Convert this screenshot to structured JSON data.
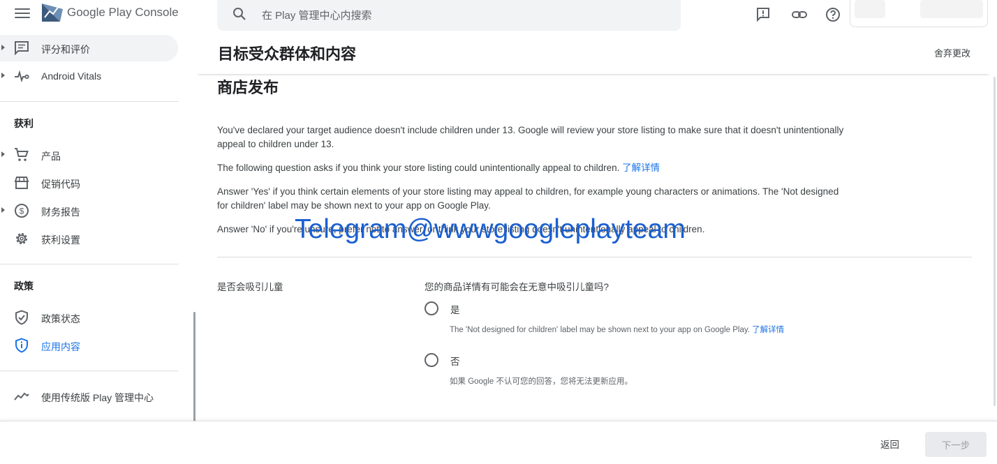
{
  "app": {
    "brand_prefix": "Google Play",
    "brand_suffix": "Console"
  },
  "search": {
    "placeholder": "在 Play 管理中心内搜索"
  },
  "sidebar": {
    "items_top": [
      {
        "label": "评分和评价",
        "icon": "reviews-icon"
      },
      {
        "label": "Android Vitals",
        "icon": "vitals-icon"
      }
    ],
    "monetize_title": "获利",
    "monetize_items": [
      {
        "label": "产品",
        "icon": "cart-icon"
      },
      {
        "label": "促销代码",
        "icon": "store-icon"
      },
      {
        "label": "财务报告",
        "icon": "dollar-icon"
      },
      {
        "label": "获利设置",
        "icon": "gear-icon"
      }
    ],
    "policy_title": "政策",
    "policy_items": [
      {
        "label": "政策状态",
        "icon": "shield-check-icon"
      },
      {
        "label": "应用内容",
        "icon": "shield-info-icon",
        "active": true
      }
    ],
    "legacy_item": {
      "label": "使用传统版 Play 管理中心",
      "icon": "trend-icon"
    }
  },
  "header": {
    "title": "目标受众群体和内容",
    "discard_label": "舍弃更改"
  },
  "content": {
    "section_title": "商店发布",
    "para1": "You've declared your target audience doesn't include children under 13. Google will review your store listing to make sure that it doesn't unintentionally appeal to children under 13.",
    "para2": "The following question asks if you think your store listing could unintentionally appeal to children.",
    "para2_link": "了解详情",
    "para3": "Answer 'Yes' if you think certain elements of your store listing may appeal to children, for example young characters or animations. The 'Not designed for children' label may be shown next to your app on Google Play.",
    "para4": "Answer 'No' if you're unsure, prefer not to answer, or think your store listing doesn't unintentionally appeal to children.",
    "question_label": "是否会吸引儿童",
    "question_text": "您的商品详情有可能会在无意中吸引儿童吗?",
    "options": [
      {
        "label": "是",
        "help": "The 'Not designed for children' label may be shown next to your app on Google Play.",
        "help_link": "了解详情"
      },
      {
        "label": "否",
        "help": "如果 Google 不认可您的回答，您将无法更新应用。"
      }
    ]
  },
  "watermark": "Telegram@wwwgoogleplayteam",
  "footer": {
    "back_label": "返回",
    "next_label": "下一步"
  },
  "colors": {
    "accent": "#1a73e8",
    "watermark": "#1a5fd0",
    "nav_highlight": "#f1f3f4"
  }
}
